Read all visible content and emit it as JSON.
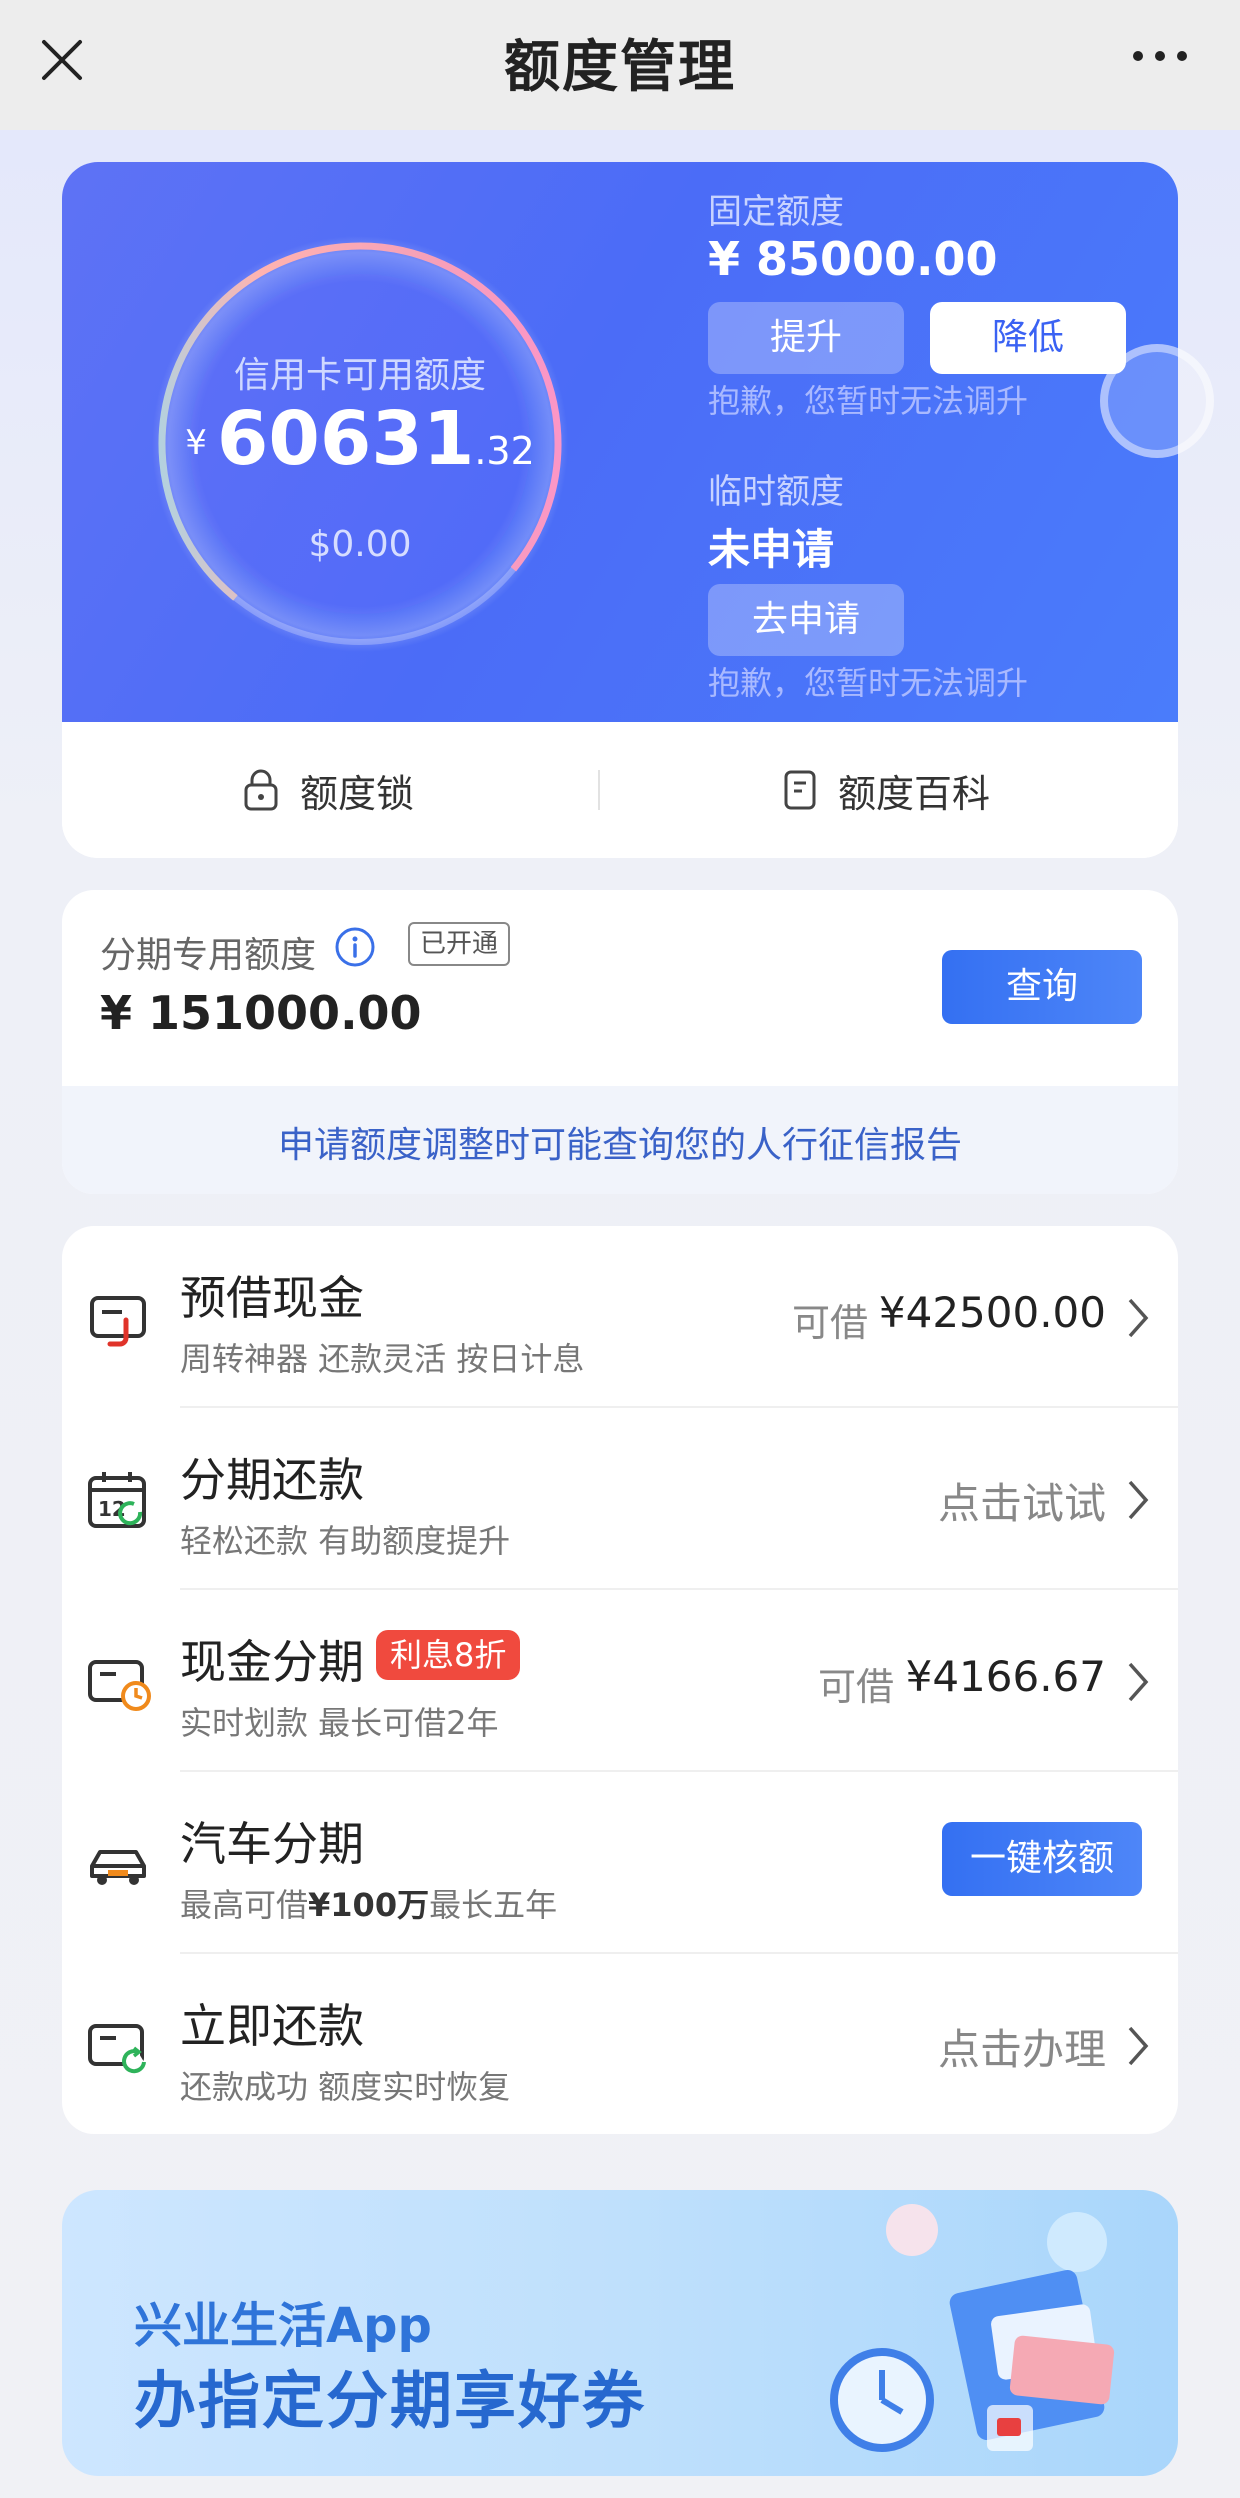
{
  "header": {
    "title": "额度管理",
    "close_icon": "close-icon",
    "more_icon": "more-icon"
  },
  "credit": {
    "ring_label": "信用卡可用额度",
    "currency": "¥",
    "available_int": "60631",
    "available_dec": ".32",
    "usd": "$0.00",
    "fixed_label": "固定额度",
    "fixed_amount": "¥ 85000.00",
    "raise_label": "提升",
    "lower_label": "降低",
    "sorry_text": "抱歉，您暂时无法调升",
    "temp_label": "临时额度",
    "temp_status": "未申请",
    "apply_label": "去申请",
    "sorry_text2": "抱歉，您暂时无法调升"
  },
  "quick": {
    "lock_label": "额度锁",
    "wiki_label": "额度百科"
  },
  "installment": {
    "label": "分期专用额度",
    "badge": "已开通",
    "amount": "¥ 151000.00",
    "query_label": "查询",
    "note": "申请额度调整时可能查询您的人行征信报告"
  },
  "list": {
    "cash_advance": {
      "name": "预借现金",
      "desc": "周转神器 还款灵活 按日计息",
      "pre": "可借",
      "amount": "¥42500.00"
    },
    "installment_repay": {
      "name": "分期还款",
      "desc": "轻松还款 有助额度提升",
      "action": "点击试试"
    },
    "cash_installment": {
      "name": "现金分期",
      "tag": "利息8折",
      "desc": "实时划款 最长可借2年",
      "pre": "可借",
      "amount": "¥4166.67"
    },
    "car_installment": {
      "name": "汽车分期",
      "desc_pre": "最高可借",
      "desc_bold": "¥100万",
      "desc_post": "最长五年",
      "button": "一键核额"
    },
    "repay_now": {
      "name": "立即还款",
      "desc": "还款成功 额度实时恢复",
      "action": "点击办理"
    }
  },
  "banner": {
    "line1": "兴业生活App",
    "line2": "办指定分期享好券"
  },
  "colors": {
    "brand_blue": "#4b6cf7",
    "accent_red": "#f04a3e",
    "link_blue": "#3a62c8"
  }
}
